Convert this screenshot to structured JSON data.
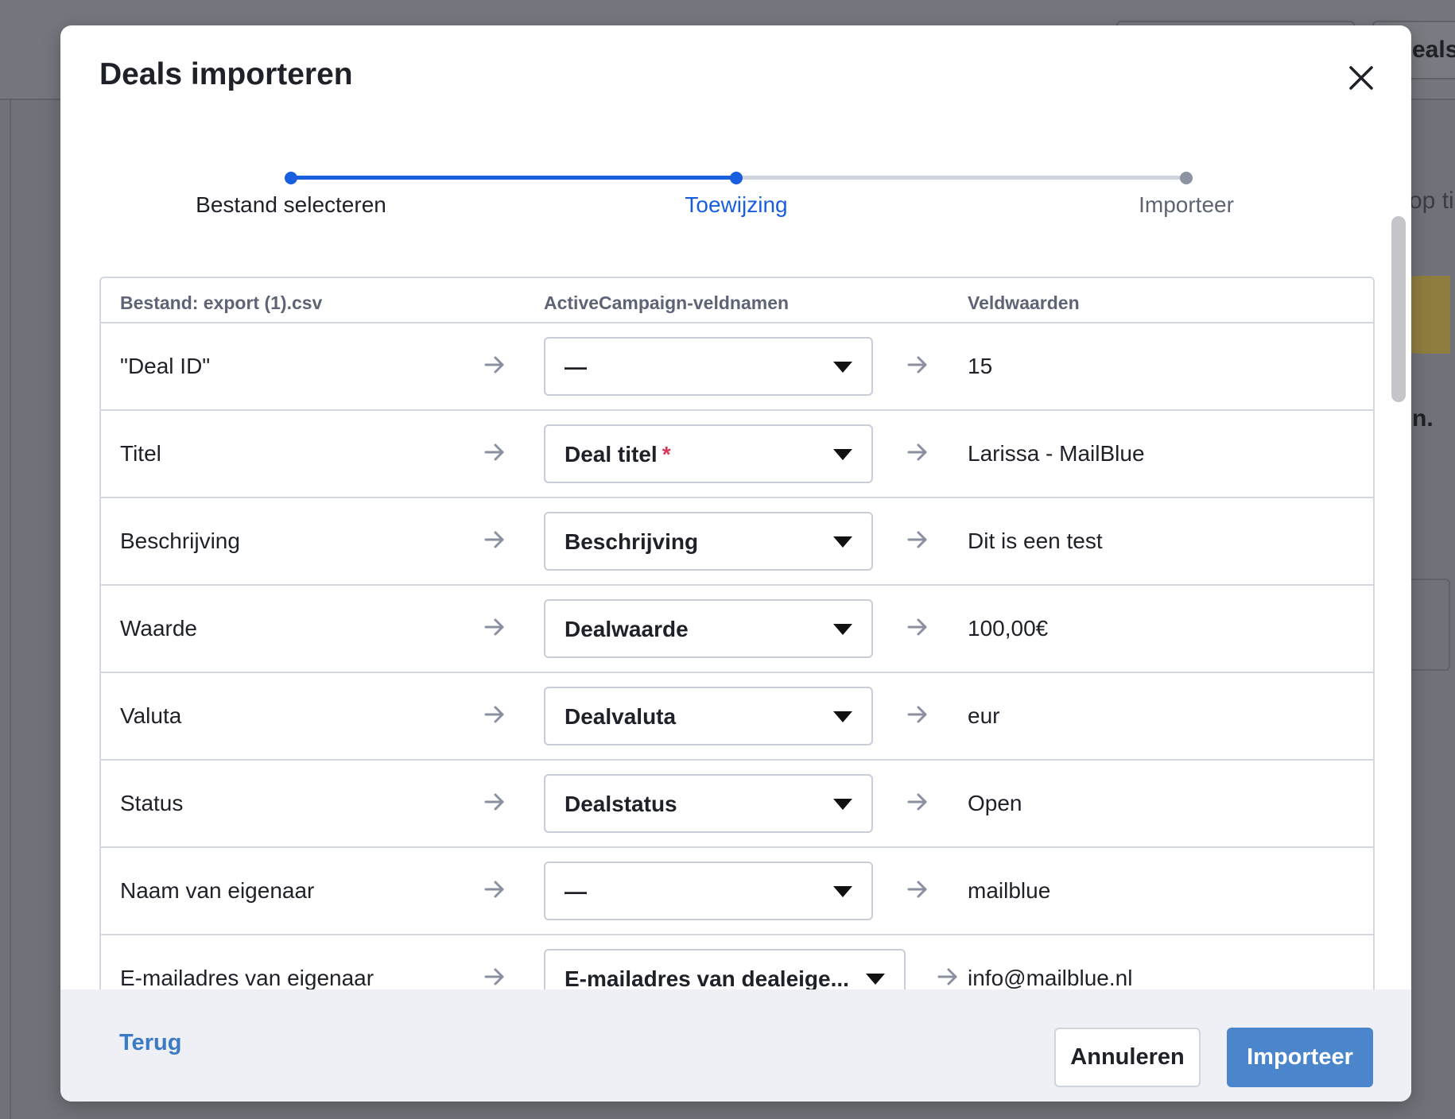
{
  "background": {
    "top_right_text": "eals",
    "side_text_1": "op ti",
    "side_text_2": "n."
  },
  "modal": {
    "title": "Deals importeren"
  },
  "stepper": {
    "steps": [
      {
        "label": "Bestand selecteren",
        "state": "done"
      },
      {
        "label": "Toewijzing",
        "state": "active"
      },
      {
        "label": "Importeer",
        "state": "upcoming"
      }
    ]
  },
  "table": {
    "headers": {
      "file": "Bestand: export (1).csv",
      "fields": "ActiveCampaign-veldnamen",
      "values": "Veldwaarden"
    },
    "rows": [
      {
        "source": "\"Deal ID\"",
        "mapping": "—",
        "required": false,
        "value": "15"
      },
      {
        "source": "Titel",
        "mapping": "Deal titel",
        "required": true,
        "value": "Larissa - MailBlue"
      },
      {
        "source": "Beschrijving",
        "mapping": "Beschrijving",
        "required": false,
        "value": "Dit is een test"
      },
      {
        "source": "Waarde",
        "mapping": "Dealwaarde",
        "required": false,
        "value": "100,00€"
      },
      {
        "source": "Valuta",
        "mapping": "Dealvaluta",
        "required": false,
        "value": "eur"
      },
      {
        "source": "Status",
        "mapping": "Dealstatus",
        "required": false,
        "value": "Open"
      },
      {
        "source": "Naam van eigenaar",
        "mapping": "—",
        "required": false,
        "value": "mailblue"
      },
      {
        "source": "E-mailadres van eigenaar",
        "mapping": "E-mailadres van dealeige...",
        "required": false,
        "value": "info@mailblue.nl"
      }
    ],
    "required_marker": "*"
  },
  "footer": {
    "back_label": "Terug",
    "cancel_label": "Annuleren",
    "import_label": "Importeer"
  },
  "colors": {
    "accent": "#1a5ee0",
    "primary_button": "#4b86cc",
    "link": "#3b7ac4",
    "required": "#d6385b"
  }
}
